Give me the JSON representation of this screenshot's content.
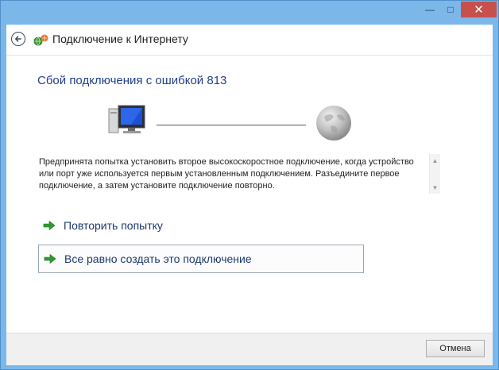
{
  "window": {
    "titlebar_buttons": {
      "minimize": "—",
      "maximize": "□",
      "close": "✕"
    }
  },
  "nav": {
    "title": "Подключение к Интернету",
    "back_icon": "back-arrow-icon",
    "app_icon": "network-connection-icon"
  },
  "content": {
    "heading": "Сбой подключения с ошибкой 813",
    "message": "Предпринята попытка установить второе высокоскоростное подключение, когда устройство или порт уже используется первым установленным подключением. Разъедините первое подключение, а затем установите подключение повторно.",
    "scroll_up": "▲",
    "scroll_down": "▼",
    "illustration": {
      "left_icon": "computer-icon",
      "right_icon": "globe-icon"
    }
  },
  "actions": {
    "retry_label": "Повторить попытку",
    "create_label": "Все равно создать это подключение",
    "arrow_color": "#2e9b2e"
  },
  "footer": {
    "cancel_label": "Отмена"
  },
  "colors": {
    "frame": "#7cb7ea",
    "heading": "#1f3f8a",
    "close_button": "#c7504c"
  }
}
